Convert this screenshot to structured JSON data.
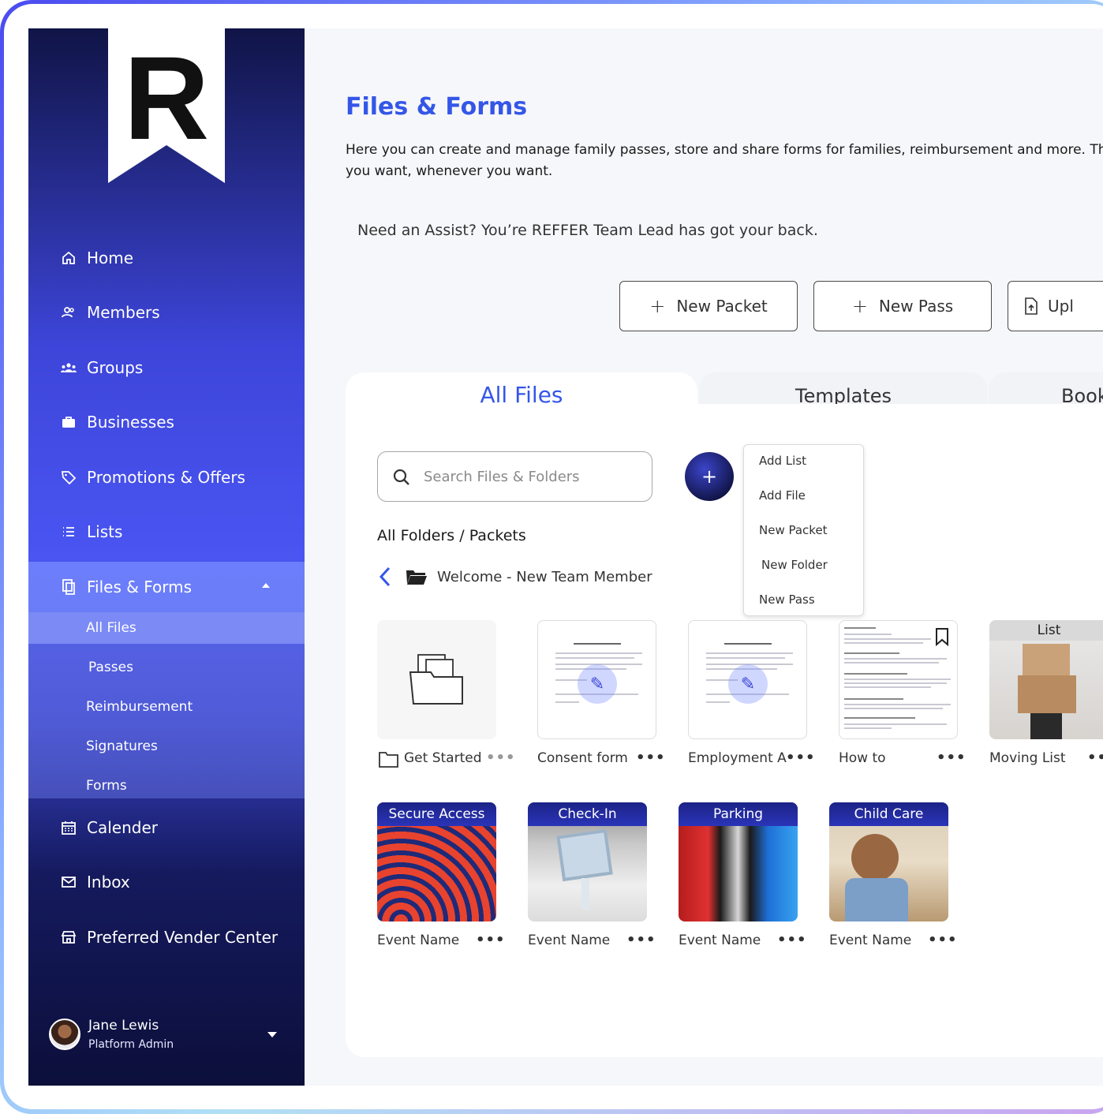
{
  "brand": {
    "logo_letter": "R"
  },
  "sidebar": {
    "items": [
      {
        "label": "Home",
        "icon": "home-icon"
      },
      {
        "label": "Members",
        "icon": "members-icon"
      },
      {
        "label": "Groups",
        "icon": "groups-icon"
      },
      {
        "label": "Businesses",
        "icon": "briefcase-icon"
      },
      {
        "label": "Promotions & Offers",
        "icon": "tag-icon"
      },
      {
        "label": "Lists",
        "icon": "list-icon"
      },
      {
        "label": "Files & Forms",
        "icon": "files-icon"
      },
      {
        "label": "Calender",
        "icon": "calendar-icon"
      },
      {
        "label": "Inbox",
        "icon": "inbox-icon"
      },
      {
        "label": "Preferred Vender Center",
        "icon": "store-icon"
      }
    ],
    "sub_items": [
      "All Files",
      "Passes",
      "Reimbursement",
      "Signatures",
      "Forms"
    ],
    "user": {
      "name": "Jane Lewis",
      "role": "Platform Admin"
    }
  },
  "main": {
    "title": "Files & Forms",
    "description_line1": "Here you can create and manage family passes,  store and share forms for families, reimbursement and more. This makes",
    "description_line2": "you want, whenever you want.",
    "assist": "Need an Assist? You’re REFFER Team Lead has got your back.",
    "buttons": [
      {
        "label": "New Packet",
        "icon": "plus-icon"
      },
      {
        "label": "New Pass",
        "icon": "plus-icon"
      },
      {
        "label": "Upl",
        "icon": "upload-file-icon"
      }
    ],
    "tabs": [
      "All Files",
      "Templates",
      "Book"
    ],
    "search": {
      "placeholder": "Search Files & Folders"
    },
    "fab": "+",
    "add_menu": [
      "Add List",
      "Add File",
      "New Packet",
      "New Folder",
      "New Pass"
    ],
    "folders_label": "All Folders / Packets",
    "breadcrumb": "Welcome - New Team Member",
    "files": [
      {
        "label": "Get Started"
      },
      {
        "label": "Consent form"
      },
      {
        "label": "Employment A"
      },
      {
        "label": "How to"
      },
      {
        "label": "Moving List",
        "banner": "List"
      }
    ],
    "events": [
      {
        "banner": "Secure Access",
        "label": "Event Name"
      },
      {
        "banner": "Check-In",
        "label": "Event Name"
      },
      {
        "banner": "Parking",
        "label": "Event Name"
      },
      {
        "banner": "Child Care",
        "label": "Event Name"
      }
    ],
    "more": "•••"
  },
  "colors": {
    "accent": "#3456e8",
    "sidebar_dark": "#101446",
    "sidebar_mid": "#4a55f2"
  }
}
